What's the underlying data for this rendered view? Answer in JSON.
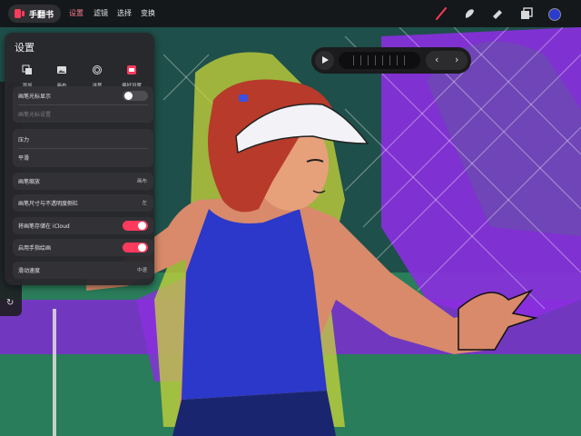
{
  "app": {
    "name": "手翻书"
  },
  "menu": [
    {
      "label": "设置",
      "active": true
    },
    {
      "label": "滤镜",
      "active": false
    },
    {
      "label": "选择",
      "active": false
    },
    {
      "label": "变换",
      "active": false
    }
  ],
  "tools": {
    "brush": "brush-icon",
    "smudge": "smudge-icon",
    "eraser": "eraser-icon",
    "layers": "layers-icon",
    "color": "#2a3ccf"
  },
  "sidebar": {
    "redo_icon": "redo-icon"
  },
  "playback": {
    "play_icon": "play-icon",
    "prev_icon": "chevron-left-icon",
    "next_icon": "chevron-right-icon"
  },
  "settings": {
    "title": "设置",
    "quick_actions": [
      {
        "label": "添加",
        "icon": "copy-icon"
      },
      {
        "label": "画布",
        "icon": "image-icon"
      },
      {
        "label": "洋葱",
        "icon": "onion-skin-icon"
      },
      {
        "label": "偏好设置",
        "icon": "preferences-icon"
      }
    ],
    "cursor_display": {
      "label": "画笔光标显示",
      "on": false
    },
    "cursor_settings": {
      "label": "画笔光标设置"
    },
    "pressure": {
      "label": "压力"
    },
    "smoothing": {
      "label": "平滑"
    },
    "brush_scaling": {
      "label": "画笔缩放",
      "value": "画布"
    },
    "size_opacity_sidebar": {
      "label": "画笔尺寸与不透明度侧栏",
      "value": "左"
    },
    "store_icloud": {
      "label": "将画笔存储在 iCloud",
      "on": true
    },
    "finger_painting": {
      "label": "启用手指绘画",
      "on": true
    },
    "scroll_speed": {
      "label": "滑动速度",
      "value": "中速"
    }
  },
  "colors": {
    "accent": "#ff3a5c",
    "panel": "#28282c",
    "card": "#323236"
  }
}
